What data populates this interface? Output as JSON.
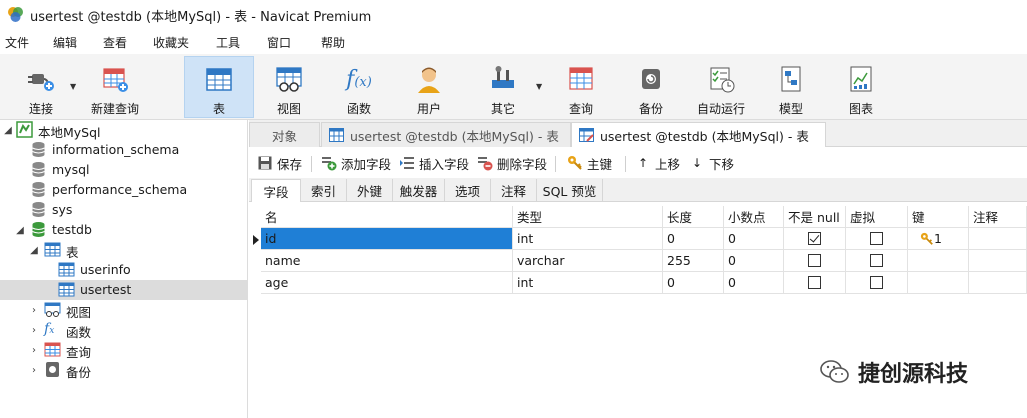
{
  "window": {
    "title": "usertest @testdb (本地MySql) - 表 - Navicat Premium"
  },
  "menu": [
    "文件",
    "编辑",
    "查看",
    "收藏夹",
    "工具",
    "窗口",
    "帮助"
  ],
  "toolbar": {
    "connect": "连接",
    "new_query": "新建查询",
    "table": "表",
    "view": "视图",
    "function": "函数",
    "user": "用户",
    "other": "其它",
    "query": "查询",
    "backup": "备份",
    "automation": "自动运行",
    "model": "模型",
    "chart": "图表"
  },
  "sidebar": {
    "connection": "本地MySql",
    "databases": [
      "information_schema",
      "mysql",
      "performance_schema",
      "sys",
      "testdb"
    ],
    "tables_group": "表",
    "tables": [
      "userinfo",
      "usertest"
    ],
    "views": "视图",
    "functions": "函数",
    "queries": "查询",
    "backups": "备份"
  },
  "tabs": {
    "objects": "对象",
    "tab1": "usertest @testdb (本地MySql) - 表",
    "tab2": "usertest @testdb (本地MySql) - 表"
  },
  "edit": {
    "save": "保存",
    "add_field": "添加字段",
    "insert_field": "插入字段",
    "delete_field": "删除字段",
    "primary_key": "主键",
    "move_up": "上移",
    "move_down": "下移"
  },
  "subtabs": [
    "字段",
    "索引",
    "外键",
    "触发器",
    "选项",
    "注释",
    "SQL 预览"
  ],
  "fields": {
    "columns": [
      "名",
      "类型",
      "长度",
      "小数点",
      "不是 null",
      "虚拟",
      "键",
      "注释"
    ],
    "rows": [
      {
        "name": "id",
        "type": "int",
        "length": "0",
        "decimals": "0",
        "not_null": true,
        "virtual": false,
        "key": "1"
      },
      {
        "name": "name",
        "type": "varchar",
        "length": "255",
        "decimals": "0",
        "not_null": false,
        "virtual": false,
        "key": ""
      },
      {
        "name": "age",
        "type": "int",
        "length": "0",
        "decimals": "0",
        "not_null": false,
        "virtual": false,
        "key": ""
      }
    ]
  },
  "watermark": "捷创源科技"
}
